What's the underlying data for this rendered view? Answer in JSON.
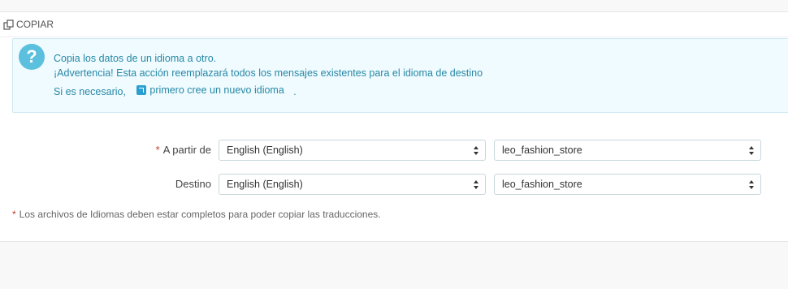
{
  "panel": {
    "title": "COPIAR",
    "icon": "copy-icon"
  },
  "info": {
    "icon": "question-icon",
    "line1": "Copia los datos de un idioma a otro.",
    "line2": "¡Advertencia! Esta acción reemplazará todos los mensajes existentes para el idioma de destino",
    "line3_prefix": "Si es necesario,",
    "link_label": "primero cree un nuevo idioma",
    "line3_suffix": "."
  },
  "form": {
    "from": {
      "required_mark": "*",
      "label": "A partir de",
      "language": "English (English)",
      "theme": "leo_fashion_store"
    },
    "to": {
      "label": "Destino",
      "language": "English (English)",
      "theme": "leo_fashion_store"
    }
  },
  "footnote": {
    "required_mark": "*",
    "text": "Los archivos de Idiomas deben estar completos para poder copiar las traducciones."
  }
}
